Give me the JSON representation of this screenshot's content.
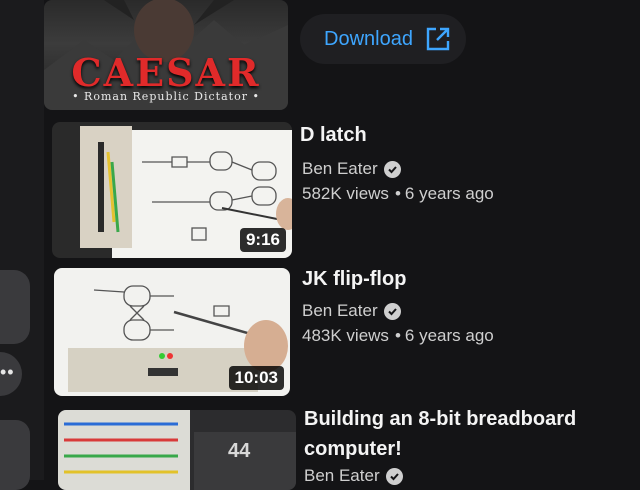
{
  "download": {
    "label": "Download"
  },
  "top_thumb": {
    "title": "CAESAR",
    "subtitle": "• Roman Republic Dictator •"
  },
  "videos": [
    {
      "title": "D latch",
      "channel": "Ben Eater",
      "views": "582K views",
      "age": "6 years ago",
      "duration": "9:16"
    },
    {
      "title": "JK flip-flop",
      "channel": "Ben Eater",
      "views": "483K views",
      "age": "6 years ago",
      "duration": "10:03"
    },
    {
      "title_line1": "Building an 8-bit breadboard",
      "title_line2": "computer!",
      "channel": "Ben Eater",
      "count": "44"
    }
  ],
  "colors": {
    "accent": "#3ea6ff",
    "background": "#141416"
  },
  "icons": [
    "open-external-icon",
    "verified-check-icon",
    "more-dots-icon"
  ]
}
